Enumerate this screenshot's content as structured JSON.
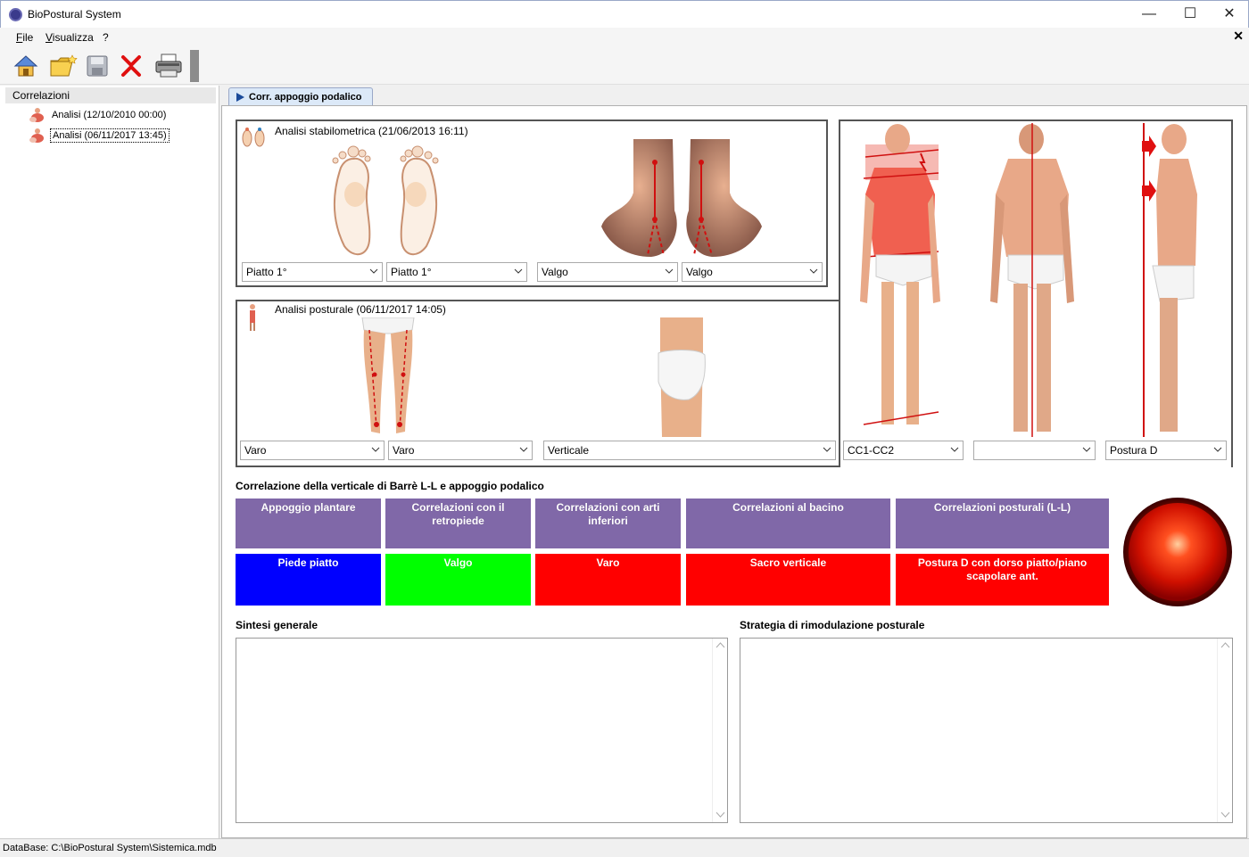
{
  "window": {
    "title": "BioPostural System"
  },
  "menu": {
    "file": "File",
    "view": "Visualizza",
    "help": "?"
  },
  "left_panel": {
    "header": "Correlazioni",
    "items": [
      {
        "label": "Analisi (12/10/2010 00:00)"
      },
      {
        "label": "Analisi (06/11/2017 13:45)"
      }
    ]
  },
  "tab": {
    "label": "Corr. appoggio podalico"
  },
  "stabilometric": {
    "title": "Analisi stabilometrica (21/06/2013 16:11)",
    "combos": [
      "Piatto 1°",
      "Piatto 1°",
      "Valgo",
      "Valgo"
    ]
  },
  "postural": {
    "title": "Analisi posturale (06/11/2017 14:05)",
    "combos": [
      "Varo",
      "Varo",
      "Verticale",
      "CC1-CC2",
      "",
      "Postura D"
    ]
  },
  "correlation": {
    "title": "Correlazione della verticale di Barrè L-L e appoggio podalico",
    "headers": [
      "Appoggio plantare",
      "Correlazioni con il retropiede",
      "Correlazioni con arti inferiori",
      "Correlazioni al bacino",
      "Correlazioni posturali (L-L)"
    ],
    "values": [
      "Piede piatto",
      "Valgo",
      "Varo",
      "Sacro verticale",
      "Postura D con dorso piatto/piano scapolare ant."
    ],
    "value_colors": [
      "#0000ff",
      "#00ff00",
      "#ff0000",
      "#ff0000",
      "#ff0000"
    ],
    "header_color": "#8068a8"
  },
  "summary": {
    "title": "Sintesi generale"
  },
  "strategy": {
    "title": "Strategia di rimodulazione posturale"
  },
  "status": {
    "text": "DataBase: C:\\BioPostural System\\Sistemica.mdb"
  }
}
